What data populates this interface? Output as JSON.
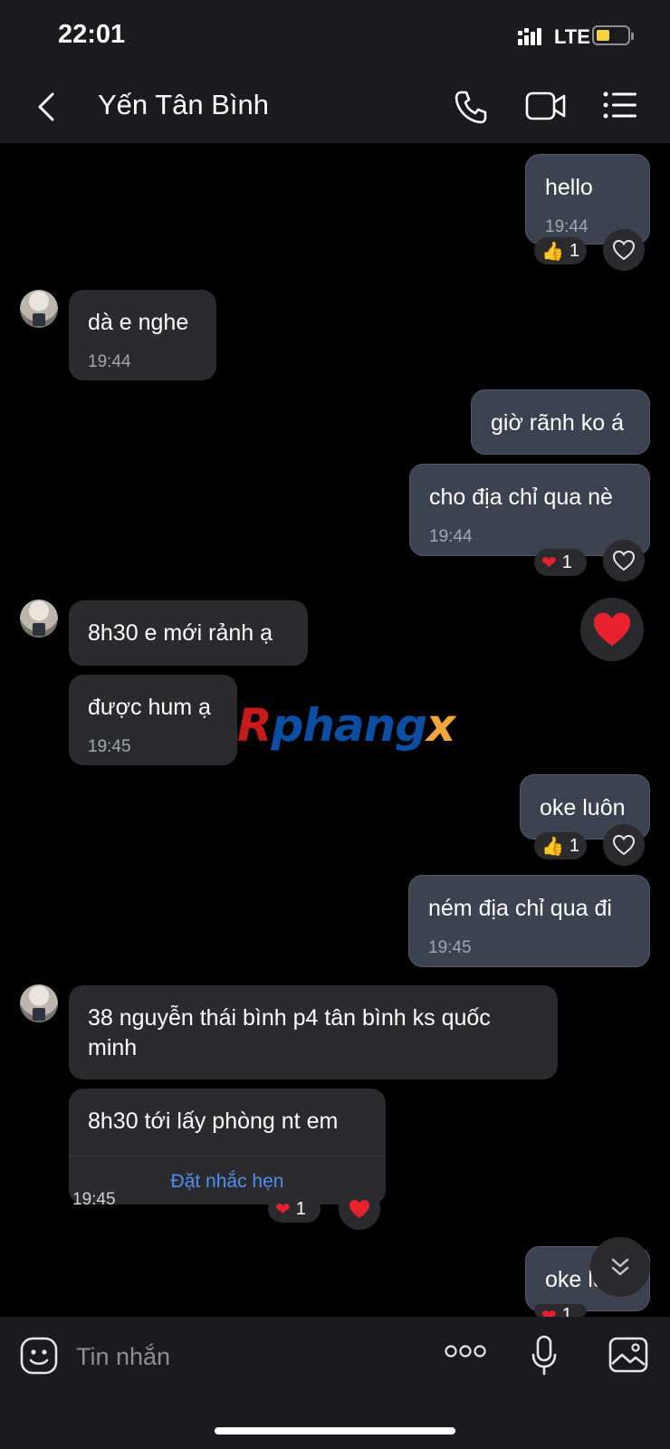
{
  "status": {
    "time": "22:01",
    "network": "LTE"
  },
  "header": {
    "title": "Yến Tân Bình"
  },
  "messages": [
    {
      "text": "hello",
      "time": "19:44",
      "reaction": "1"
    },
    {
      "text": "dà e nghe",
      "time": "19:44"
    },
    {
      "text": "giờ rãnh ko á"
    },
    {
      "text": "cho địa chỉ qua nè",
      "time": "19:44",
      "reaction": "1"
    },
    {
      "text": "8h30 e mới rảnh ạ"
    },
    {
      "text": "được hum ạ",
      "time": "19:45"
    },
    {
      "text": "oke luôn",
      "reaction": "1"
    },
    {
      "text": "ném địa chỉ qua đi",
      "time": "19:45"
    },
    {
      "text": "38 nguyễn thái bình p4 tân bình ks quốc minh"
    },
    {
      "text": "8h30 tới lấy phòng nt em",
      "action": "Đặt nhắc hẹn",
      "reaction": "1",
      "time": "19:45"
    },
    {
      "text": "oke luôn",
      "reaction": "1"
    }
  ],
  "watermark": {
    "part1": "R",
    "part2": "phang",
    "part3": "x"
  },
  "composer": {
    "placeholder": "Tin nhắn"
  },
  "colors": {
    "bar_bg": "#1b1b1d",
    "incoming_bubble": "#2b2b2e",
    "outgoing_bubble": "#3c4250",
    "link": "#4d8ff2",
    "heart": "#e8212e"
  }
}
